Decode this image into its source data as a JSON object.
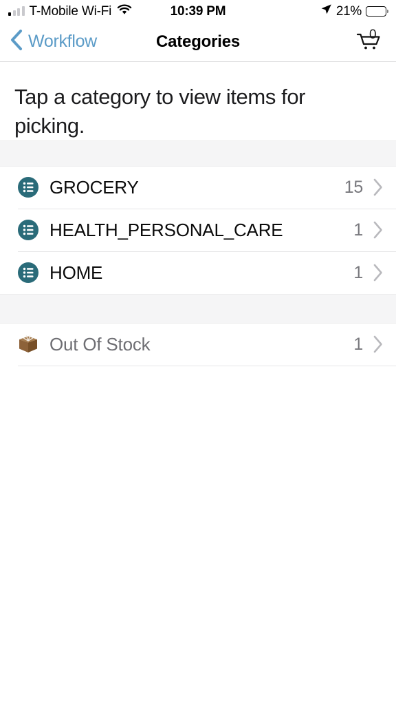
{
  "status_bar": {
    "carrier": "T-Mobile Wi-Fi",
    "wifi_icon": "wifi-icon",
    "signal_icon": "cellular-signal-icon",
    "time": "10:39 PM",
    "location_icon": "location-arrow-icon",
    "battery_percent": "21%",
    "battery_level": 21,
    "battery_icon": "battery-icon"
  },
  "nav_bar": {
    "back_icon": "chevron-left-icon",
    "back_label": "Workflow",
    "title": "Categories",
    "cart_icon": "shopping-cart-icon",
    "cart_count": "0"
  },
  "main": {
    "instruction": "Tap a category to view items for picking."
  },
  "categories": [
    {
      "icon": "list-circle-icon",
      "label": "GROCERY",
      "count": "15",
      "chevron": "chevron-right-icon"
    },
    {
      "icon": "list-circle-icon",
      "label": "HEALTH_PERSONAL_CARE",
      "count": "1",
      "chevron": "chevron-right-icon"
    },
    {
      "icon": "list-circle-icon",
      "label": "HOME",
      "count": "1",
      "chevron": "chevron-right-icon"
    }
  ],
  "special": [
    {
      "icon": "box-icon",
      "label": "Out Of Stock",
      "count": "1",
      "chevron": "chevron-right-icon"
    }
  ],
  "colors": {
    "accent_blue": "#5b9bc7",
    "category_icon_teal": "#2a6b79",
    "out_of_stock_brown": "#8d6239",
    "count_grey": "#79797e",
    "section_band": "#f5f5f6"
  }
}
